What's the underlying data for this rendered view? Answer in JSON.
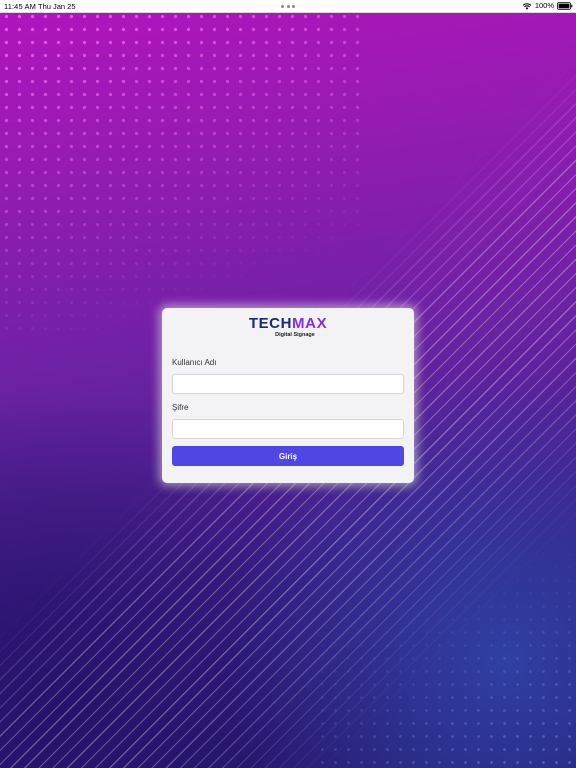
{
  "status_bar": {
    "time": "11:45 AM",
    "date": "Thu Jan 25",
    "battery": "100%",
    "icons": [
      "wifi-icon",
      "battery-icon",
      "more-dots-icon"
    ]
  },
  "login_card": {
    "logo": {
      "word_part1": "TECH",
      "word_part2": "MAX",
      "subtitle": "Digital Signage"
    },
    "username_label": "Kullanıcı Adı",
    "username_value": "",
    "password_label": "Şifre",
    "password_value": "",
    "submit_label": "Giriş"
  },
  "colors": {
    "accent_button": "#4f46e5",
    "logo_dark": "#1a2a6e",
    "logo_accent": "#8a2be2",
    "background_top": "#b214be",
    "background_bottom": "#24166a"
  }
}
